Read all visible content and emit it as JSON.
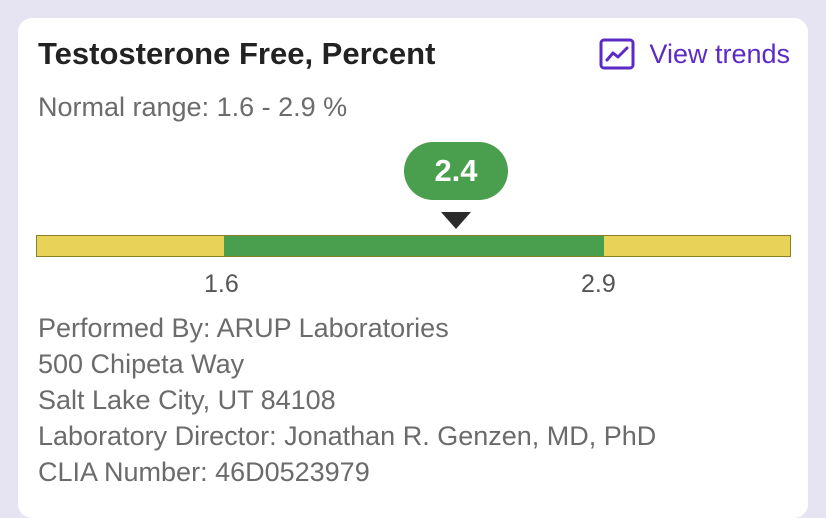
{
  "result": {
    "title": "Testosterone Free, Percent",
    "view_trends_label": "View trends",
    "normal_range_text": "Normal range: 1.6 - 2.9 %",
    "value": "2.4",
    "range_low": "1.6",
    "range_high": "2.9"
  },
  "lab_info": {
    "performed_by": "Performed By: ARUP Laboratories",
    "address_line1": "500 Chipeta Way",
    "address_line2": "Salt Lake City, UT 84108",
    "director": "Laboratory Director: Jonathan R. Genzen, MD, PhD",
    "clia": "CLIA Number: 46D0523979"
  },
  "icons": {
    "trends": "trend-chart-icon"
  },
  "colors": {
    "accent": "#5b2bc5",
    "normal": "#4a9f4e",
    "out_of_range": "#e8d257",
    "background": "#e6e3f3"
  }
}
